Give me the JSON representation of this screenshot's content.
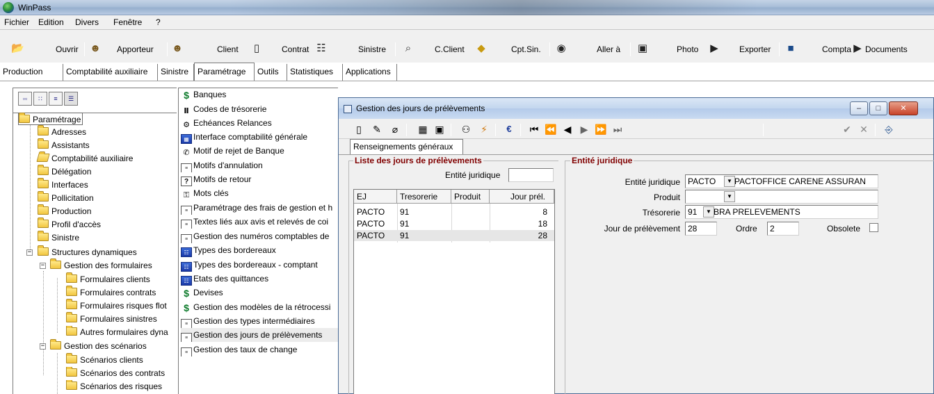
{
  "window": {
    "title": "WinPass"
  },
  "menu": [
    "Fichier",
    "Edition",
    "Divers",
    "Fenêtre",
    "?"
  ],
  "toolbar": {
    "ouvrir": "Ouvrir",
    "apporteur": "Apporteur",
    "client": "Client",
    "contrat": "Contrat",
    "sinistre": "Sinistre",
    "cclient": "C.Client",
    "cptsin": "Cpt.Sin.",
    "allera": "Aller à",
    "photo": "Photo",
    "exporter": "Exporter",
    "compta": "Compta",
    "documents": "Documents"
  },
  "tabs": [
    "Production",
    "Comptabilité auxiliaire",
    "Sinistre",
    "Paramétrage",
    "Outils",
    "Statistiques",
    "Applications"
  ],
  "active_tab": "Paramétrage",
  "tree": {
    "root": "Paramétrage",
    "items": [
      "Adresses",
      "Assistants",
      "Comptabilité auxiliaire",
      "Délégation",
      "Interfaces",
      "Pollicitation",
      "Production",
      "Profil d'accès",
      "Sinistre",
      "Structures dynamiques",
      "Gestion des formulaires",
      "Formulaires clients",
      "Formulaires contrats",
      "Formulaires risques flot",
      "Formulaires sinistres",
      "Autres formulaires dyna",
      "Gestion des scénarios",
      "Scénarios clients",
      "Scénarios des contrats",
      "Scénarios des risques"
    ]
  },
  "mid_list": [
    "Banques",
    "Codes de trésorerie",
    "Echéances Relances",
    "Interface comptabilité générale",
    "Motif de rejet de Banque",
    "Motifs d'annulation",
    "Motifs de retour",
    "Mots clés",
    "Paramétrage des frais de gestion et h",
    "Textes liés aux avis et relevés de coi",
    "Gestion des numéros comptables de",
    "Types des bordereaux",
    "Types des bordereaux - comptant",
    "Etats des quittances",
    "Devises",
    "Gestion des modèles de la rétrocessi",
    "Gestion des types intermédiaires",
    "Gestion des jours de prélèvements",
    "Gestion des taux de change"
  ],
  "dialog": {
    "title": "Gestion des jours de prélèvements",
    "tab": "Renseignements généraux",
    "list_group": {
      "title": "Liste des jours de prélèvements",
      "filter_label": "Entité juridique",
      "filter_value": "",
      "columns": [
        "EJ",
        "Tresorerie",
        "Produit",
        "Jour prél."
      ],
      "rows": [
        [
          "PACTO",
          "91",
          "",
          "8"
        ],
        [
          "PACTO",
          "91",
          "",
          "18"
        ],
        [
          "PACTO",
          "91",
          "",
          "28"
        ]
      ]
    },
    "entity_group": {
      "title": "Entité juridique",
      "entite_label": "Entité juridique",
      "entite_code": "PACTO",
      "entite_name": "PACTOFFICE CARENE ASSURAN",
      "produit_label": "Produit",
      "produit_code": "",
      "produit_name": "",
      "tresorerie_label": "Trésorerie",
      "tresorerie_code": "91",
      "tresorerie_name": "BRA  PRELEVEMENTS",
      "jour_label": "Jour de prélèvement",
      "jour_value": "28",
      "ordre_label": "Ordre",
      "ordre_value": "2",
      "obsolete_label": "Obsolete"
    }
  },
  "colors": {
    "group_title": "#800000",
    "dialog_border": "#4a6a95"
  }
}
